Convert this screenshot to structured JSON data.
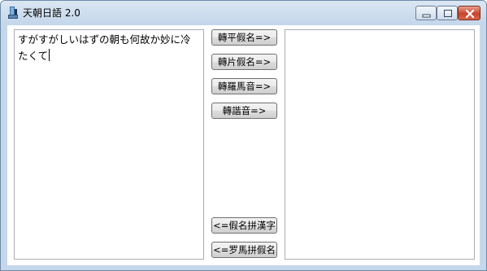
{
  "window": {
    "title": "天朝日語 2.0"
  },
  "input": {
    "text": "すがすがしいはずの朝も何故か妙に冷たくて"
  },
  "output": {
    "text": ""
  },
  "buttons": {
    "to_hiragana": "轉平假名=>",
    "to_katakana": "轉片假名=>",
    "to_romaji": "轉羅馬音=>",
    "to_homophone": "轉諧音=>",
    "kana_to_kanji": "<=假名拼漢字",
    "romaji_to_kana": "<=罗馬拼假名"
  },
  "icons": {
    "app": "app-icon",
    "minimize": "minimize-icon",
    "maximize": "maximize-icon",
    "close": "close-icon"
  }
}
